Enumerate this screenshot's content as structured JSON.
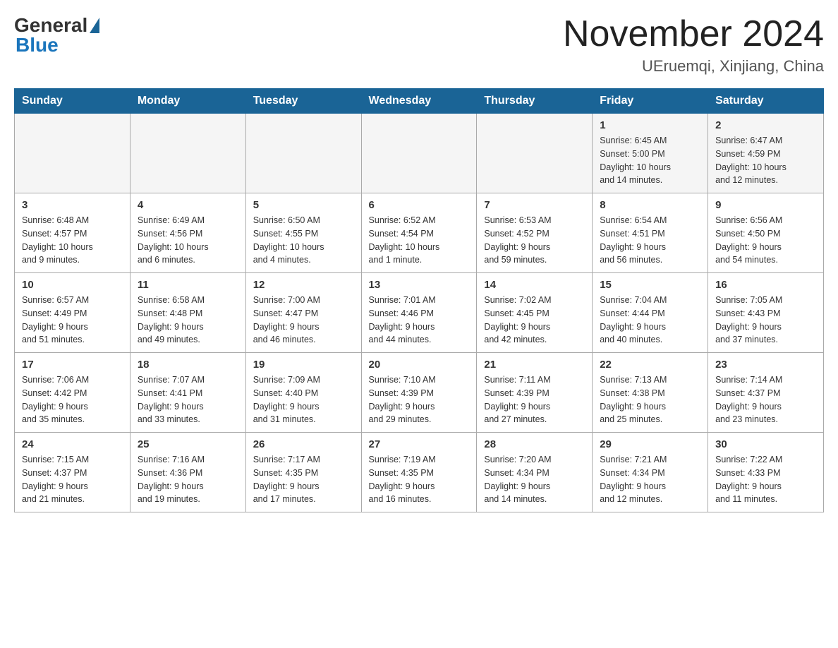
{
  "header": {
    "logo_general": "General",
    "logo_blue": "Blue",
    "title": "November 2024",
    "subtitle": "UEruemqi, Xinjiang, China"
  },
  "weekdays": [
    "Sunday",
    "Monday",
    "Tuesday",
    "Wednesday",
    "Thursday",
    "Friday",
    "Saturday"
  ],
  "weeks": [
    [
      {
        "day": "",
        "info": ""
      },
      {
        "day": "",
        "info": ""
      },
      {
        "day": "",
        "info": ""
      },
      {
        "day": "",
        "info": ""
      },
      {
        "day": "",
        "info": ""
      },
      {
        "day": "1",
        "info": "Sunrise: 6:45 AM\nSunset: 5:00 PM\nDaylight: 10 hours\nand 14 minutes."
      },
      {
        "day": "2",
        "info": "Sunrise: 6:47 AM\nSunset: 4:59 PM\nDaylight: 10 hours\nand 12 minutes."
      }
    ],
    [
      {
        "day": "3",
        "info": "Sunrise: 6:48 AM\nSunset: 4:57 PM\nDaylight: 10 hours\nand 9 minutes."
      },
      {
        "day": "4",
        "info": "Sunrise: 6:49 AM\nSunset: 4:56 PM\nDaylight: 10 hours\nand 6 minutes."
      },
      {
        "day": "5",
        "info": "Sunrise: 6:50 AM\nSunset: 4:55 PM\nDaylight: 10 hours\nand 4 minutes."
      },
      {
        "day": "6",
        "info": "Sunrise: 6:52 AM\nSunset: 4:54 PM\nDaylight: 10 hours\nand 1 minute."
      },
      {
        "day": "7",
        "info": "Sunrise: 6:53 AM\nSunset: 4:52 PM\nDaylight: 9 hours\nand 59 minutes."
      },
      {
        "day": "8",
        "info": "Sunrise: 6:54 AM\nSunset: 4:51 PM\nDaylight: 9 hours\nand 56 minutes."
      },
      {
        "day": "9",
        "info": "Sunrise: 6:56 AM\nSunset: 4:50 PM\nDaylight: 9 hours\nand 54 minutes."
      }
    ],
    [
      {
        "day": "10",
        "info": "Sunrise: 6:57 AM\nSunset: 4:49 PM\nDaylight: 9 hours\nand 51 minutes."
      },
      {
        "day": "11",
        "info": "Sunrise: 6:58 AM\nSunset: 4:48 PM\nDaylight: 9 hours\nand 49 minutes."
      },
      {
        "day": "12",
        "info": "Sunrise: 7:00 AM\nSunset: 4:47 PM\nDaylight: 9 hours\nand 46 minutes."
      },
      {
        "day": "13",
        "info": "Sunrise: 7:01 AM\nSunset: 4:46 PM\nDaylight: 9 hours\nand 44 minutes."
      },
      {
        "day": "14",
        "info": "Sunrise: 7:02 AM\nSunset: 4:45 PM\nDaylight: 9 hours\nand 42 minutes."
      },
      {
        "day": "15",
        "info": "Sunrise: 7:04 AM\nSunset: 4:44 PM\nDaylight: 9 hours\nand 40 minutes."
      },
      {
        "day": "16",
        "info": "Sunrise: 7:05 AM\nSunset: 4:43 PM\nDaylight: 9 hours\nand 37 minutes."
      }
    ],
    [
      {
        "day": "17",
        "info": "Sunrise: 7:06 AM\nSunset: 4:42 PM\nDaylight: 9 hours\nand 35 minutes."
      },
      {
        "day": "18",
        "info": "Sunrise: 7:07 AM\nSunset: 4:41 PM\nDaylight: 9 hours\nand 33 minutes."
      },
      {
        "day": "19",
        "info": "Sunrise: 7:09 AM\nSunset: 4:40 PM\nDaylight: 9 hours\nand 31 minutes."
      },
      {
        "day": "20",
        "info": "Sunrise: 7:10 AM\nSunset: 4:39 PM\nDaylight: 9 hours\nand 29 minutes."
      },
      {
        "day": "21",
        "info": "Sunrise: 7:11 AM\nSunset: 4:39 PM\nDaylight: 9 hours\nand 27 minutes."
      },
      {
        "day": "22",
        "info": "Sunrise: 7:13 AM\nSunset: 4:38 PM\nDaylight: 9 hours\nand 25 minutes."
      },
      {
        "day": "23",
        "info": "Sunrise: 7:14 AM\nSunset: 4:37 PM\nDaylight: 9 hours\nand 23 minutes."
      }
    ],
    [
      {
        "day": "24",
        "info": "Sunrise: 7:15 AM\nSunset: 4:37 PM\nDaylight: 9 hours\nand 21 minutes."
      },
      {
        "day": "25",
        "info": "Sunrise: 7:16 AM\nSunset: 4:36 PM\nDaylight: 9 hours\nand 19 minutes."
      },
      {
        "day": "26",
        "info": "Sunrise: 7:17 AM\nSunset: 4:35 PM\nDaylight: 9 hours\nand 17 minutes."
      },
      {
        "day": "27",
        "info": "Sunrise: 7:19 AM\nSunset: 4:35 PM\nDaylight: 9 hours\nand 16 minutes."
      },
      {
        "day": "28",
        "info": "Sunrise: 7:20 AM\nSunset: 4:34 PM\nDaylight: 9 hours\nand 14 minutes."
      },
      {
        "day": "29",
        "info": "Sunrise: 7:21 AM\nSunset: 4:34 PM\nDaylight: 9 hours\nand 12 minutes."
      },
      {
        "day": "30",
        "info": "Sunrise: 7:22 AM\nSunset: 4:33 PM\nDaylight: 9 hours\nand 11 minutes."
      }
    ]
  ]
}
